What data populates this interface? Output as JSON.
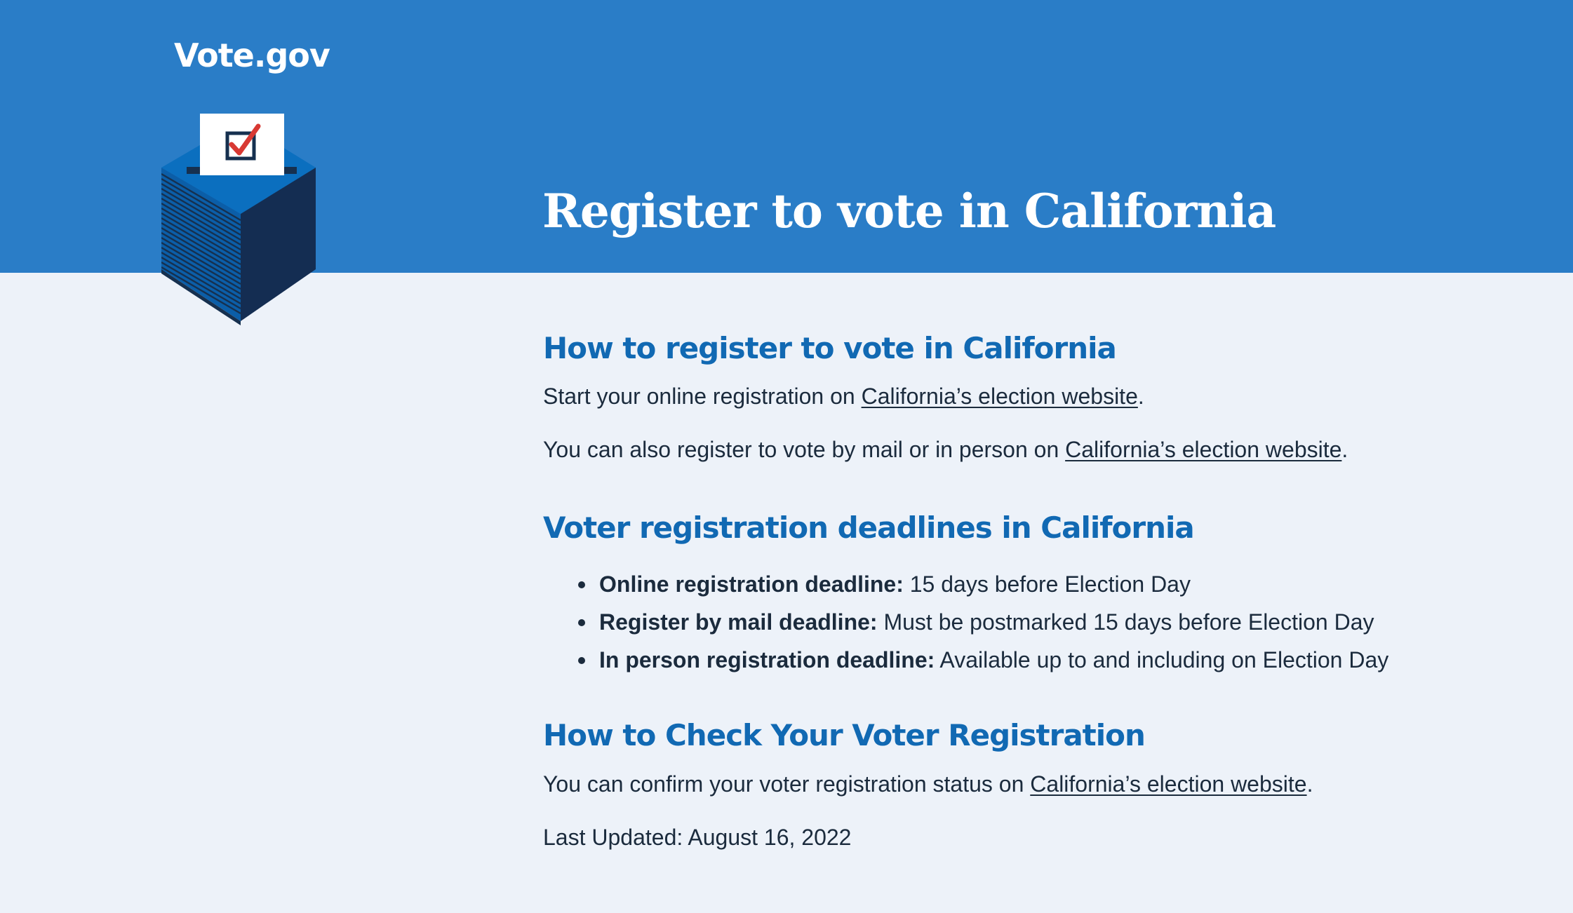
{
  "header": {
    "logo_text": "Vote.gov",
    "title": "Register to vote in California"
  },
  "sections": {
    "how_to_register": {
      "heading": "How to register to vote in California",
      "para1_prefix": "Start your online registration on ",
      "para1_link": "California’s election website",
      "para1_suffix": ".",
      "para2_prefix": "You can also register to vote by mail or in person on ",
      "para2_link": "California’s election website",
      "para2_suffix": "."
    },
    "deadlines": {
      "heading": "Voter registration deadlines in California",
      "items": [
        {
          "label": "Online registration deadline:",
          "value": " 15 days before Election Day"
        },
        {
          "label": "Register by mail deadline:",
          "value": " Must be postmarked 15 days before Election Day"
        },
        {
          "label": "In person registration deadline:",
          "value": " Available up to and including on Election Day"
        }
      ]
    },
    "check_registration": {
      "heading": "How to Check Your Voter Registration",
      "para_prefix": "You can confirm your voter registration status on ",
      "para_link": "California’s election website",
      "para_suffix": "."
    }
  },
  "last_updated": "Last Updated: August 16, 2022",
  "colors": {
    "hero_blue": "#2a7dc7",
    "heading_blue": "#1169b3",
    "page_background": "#edf2f9",
    "text_dark": "#1b2b3d",
    "check_red": "#d83933"
  },
  "icons": {
    "ballot_box": "ballot-box-icon"
  }
}
